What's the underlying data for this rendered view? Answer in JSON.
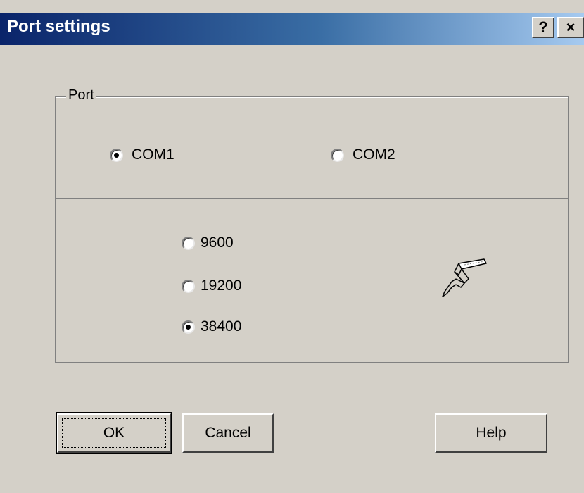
{
  "window": {
    "title": "Port settings",
    "help_button": "?",
    "close_button": "×"
  },
  "port_group": {
    "label": "Port",
    "ports": [
      {
        "label": "COM1",
        "checked": true
      },
      {
        "label": "COM2",
        "checked": false
      }
    ],
    "baud_rates": [
      {
        "label": "9600",
        "checked": false
      },
      {
        "label": "19200",
        "checked": false
      },
      {
        "label": "38400",
        "checked": true
      }
    ],
    "icon": "serial-cable-icon"
  },
  "buttons": {
    "ok": "OK",
    "cancel": "Cancel",
    "help": "Help"
  },
  "colors": {
    "dialog_bg": "#d4d0c8",
    "titlebar_start": "#0a246a",
    "titlebar_end": "#a6caf0"
  }
}
